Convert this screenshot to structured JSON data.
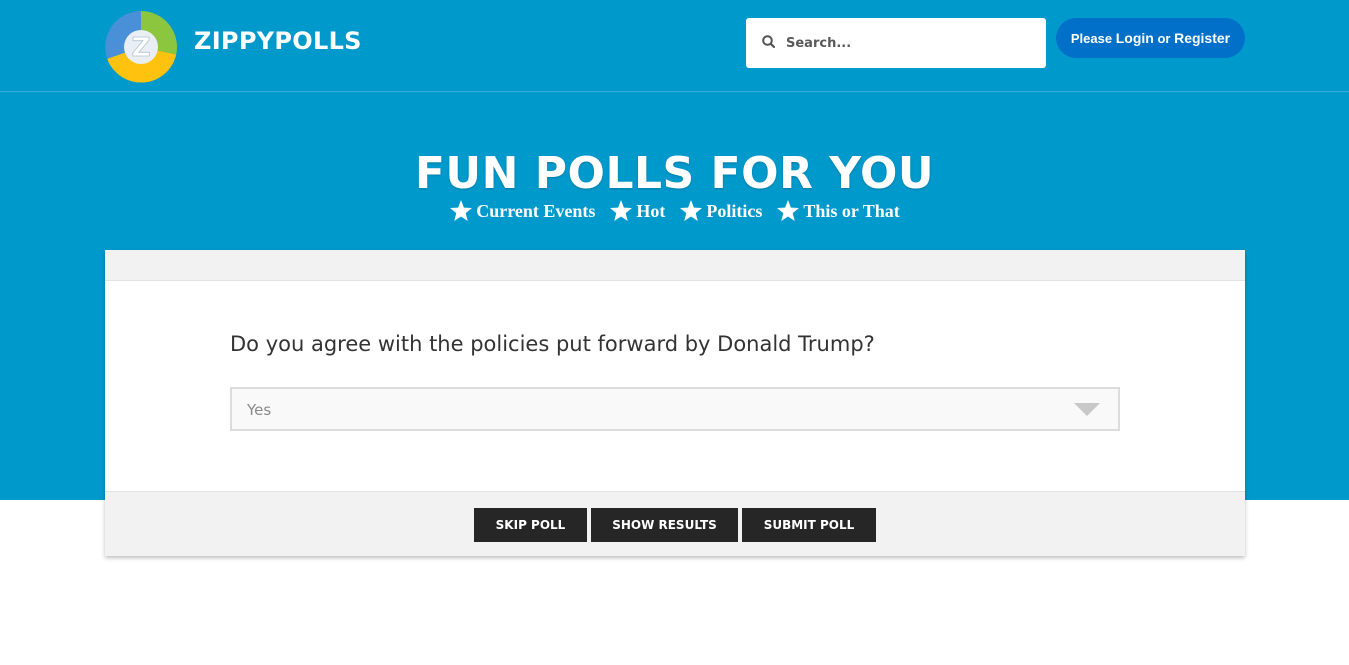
{
  "brand": {
    "name": "ZIPPYPOLLS",
    "logo_letter": "Z"
  },
  "search": {
    "placeholder": "Search...",
    "icon": "search-icon"
  },
  "auth": {
    "prefix": "Please",
    "login": "Login",
    "or": "or",
    "register": "Register"
  },
  "hero": {
    "title": "FUN POLLS FOR YOU",
    "categories": [
      {
        "label": "Current Events",
        "icon": "star-icon"
      },
      {
        "label": "Hot",
        "icon": "star-icon"
      },
      {
        "label": "Politics",
        "icon": "star-icon"
      },
      {
        "label": "This or That",
        "icon": "star-icon"
      }
    ]
  },
  "poll": {
    "question": "Do you agree with the policies put forward by Donald Trump?",
    "selected_option": "Yes",
    "buttons": {
      "skip": "SKIP POLL",
      "results": "SHOW RESULTS",
      "submit": "SUBMIT POLL"
    }
  },
  "colors": {
    "header_bg": "#0099cc",
    "login_bg": "#0070c9",
    "button_bg": "#262626",
    "card_band": "#f2f2f2"
  }
}
